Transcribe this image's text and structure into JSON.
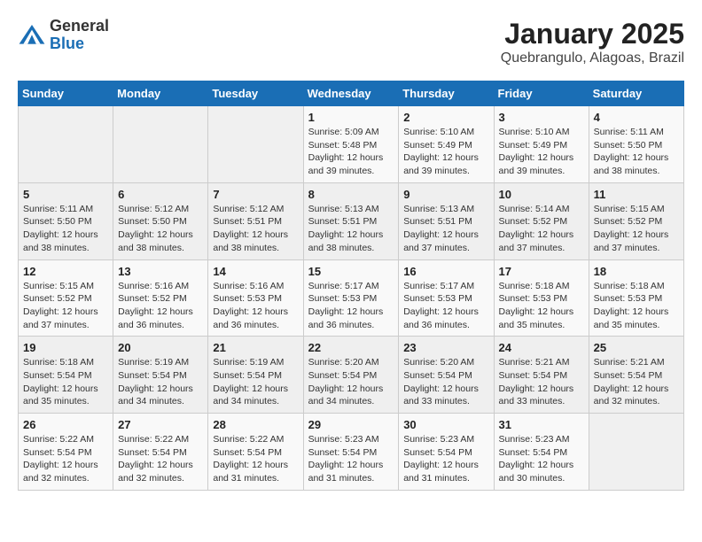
{
  "header": {
    "logo_general": "General",
    "logo_blue": "Blue",
    "title": "January 2025",
    "subtitle": "Quebrangulo, Alagoas, Brazil"
  },
  "days_of_week": [
    "Sunday",
    "Monday",
    "Tuesday",
    "Wednesday",
    "Thursday",
    "Friday",
    "Saturday"
  ],
  "weeks": [
    [
      {
        "day": "",
        "info": ""
      },
      {
        "day": "",
        "info": ""
      },
      {
        "day": "",
        "info": ""
      },
      {
        "day": "1",
        "info": "Sunrise: 5:09 AM\nSunset: 5:48 PM\nDaylight: 12 hours\nand 39 minutes."
      },
      {
        "day": "2",
        "info": "Sunrise: 5:10 AM\nSunset: 5:49 PM\nDaylight: 12 hours\nand 39 minutes."
      },
      {
        "day": "3",
        "info": "Sunrise: 5:10 AM\nSunset: 5:49 PM\nDaylight: 12 hours\nand 39 minutes."
      },
      {
        "day": "4",
        "info": "Sunrise: 5:11 AM\nSunset: 5:50 PM\nDaylight: 12 hours\nand 38 minutes."
      }
    ],
    [
      {
        "day": "5",
        "info": "Sunrise: 5:11 AM\nSunset: 5:50 PM\nDaylight: 12 hours\nand 38 minutes."
      },
      {
        "day": "6",
        "info": "Sunrise: 5:12 AM\nSunset: 5:50 PM\nDaylight: 12 hours\nand 38 minutes."
      },
      {
        "day": "7",
        "info": "Sunrise: 5:12 AM\nSunset: 5:51 PM\nDaylight: 12 hours\nand 38 minutes."
      },
      {
        "day": "8",
        "info": "Sunrise: 5:13 AM\nSunset: 5:51 PM\nDaylight: 12 hours\nand 38 minutes."
      },
      {
        "day": "9",
        "info": "Sunrise: 5:13 AM\nSunset: 5:51 PM\nDaylight: 12 hours\nand 37 minutes."
      },
      {
        "day": "10",
        "info": "Sunrise: 5:14 AM\nSunset: 5:52 PM\nDaylight: 12 hours\nand 37 minutes."
      },
      {
        "day": "11",
        "info": "Sunrise: 5:15 AM\nSunset: 5:52 PM\nDaylight: 12 hours\nand 37 minutes."
      }
    ],
    [
      {
        "day": "12",
        "info": "Sunrise: 5:15 AM\nSunset: 5:52 PM\nDaylight: 12 hours\nand 37 minutes."
      },
      {
        "day": "13",
        "info": "Sunrise: 5:16 AM\nSunset: 5:52 PM\nDaylight: 12 hours\nand 36 minutes."
      },
      {
        "day": "14",
        "info": "Sunrise: 5:16 AM\nSunset: 5:53 PM\nDaylight: 12 hours\nand 36 minutes."
      },
      {
        "day": "15",
        "info": "Sunrise: 5:17 AM\nSunset: 5:53 PM\nDaylight: 12 hours\nand 36 minutes."
      },
      {
        "day": "16",
        "info": "Sunrise: 5:17 AM\nSunset: 5:53 PM\nDaylight: 12 hours\nand 36 minutes."
      },
      {
        "day": "17",
        "info": "Sunrise: 5:18 AM\nSunset: 5:53 PM\nDaylight: 12 hours\nand 35 minutes."
      },
      {
        "day": "18",
        "info": "Sunrise: 5:18 AM\nSunset: 5:53 PM\nDaylight: 12 hours\nand 35 minutes."
      }
    ],
    [
      {
        "day": "19",
        "info": "Sunrise: 5:18 AM\nSunset: 5:54 PM\nDaylight: 12 hours\nand 35 minutes."
      },
      {
        "day": "20",
        "info": "Sunrise: 5:19 AM\nSunset: 5:54 PM\nDaylight: 12 hours\nand 34 minutes."
      },
      {
        "day": "21",
        "info": "Sunrise: 5:19 AM\nSunset: 5:54 PM\nDaylight: 12 hours\nand 34 minutes."
      },
      {
        "day": "22",
        "info": "Sunrise: 5:20 AM\nSunset: 5:54 PM\nDaylight: 12 hours\nand 34 minutes."
      },
      {
        "day": "23",
        "info": "Sunrise: 5:20 AM\nSunset: 5:54 PM\nDaylight: 12 hours\nand 33 minutes."
      },
      {
        "day": "24",
        "info": "Sunrise: 5:21 AM\nSunset: 5:54 PM\nDaylight: 12 hours\nand 33 minutes."
      },
      {
        "day": "25",
        "info": "Sunrise: 5:21 AM\nSunset: 5:54 PM\nDaylight: 12 hours\nand 32 minutes."
      }
    ],
    [
      {
        "day": "26",
        "info": "Sunrise: 5:22 AM\nSunset: 5:54 PM\nDaylight: 12 hours\nand 32 minutes."
      },
      {
        "day": "27",
        "info": "Sunrise: 5:22 AM\nSunset: 5:54 PM\nDaylight: 12 hours\nand 32 minutes."
      },
      {
        "day": "28",
        "info": "Sunrise: 5:22 AM\nSunset: 5:54 PM\nDaylight: 12 hours\nand 31 minutes."
      },
      {
        "day": "29",
        "info": "Sunrise: 5:23 AM\nSunset: 5:54 PM\nDaylight: 12 hours\nand 31 minutes."
      },
      {
        "day": "30",
        "info": "Sunrise: 5:23 AM\nSunset: 5:54 PM\nDaylight: 12 hours\nand 31 minutes."
      },
      {
        "day": "31",
        "info": "Sunrise: 5:23 AM\nSunset: 5:54 PM\nDaylight: 12 hours\nand 30 minutes."
      },
      {
        "day": "",
        "info": ""
      }
    ]
  ]
}
